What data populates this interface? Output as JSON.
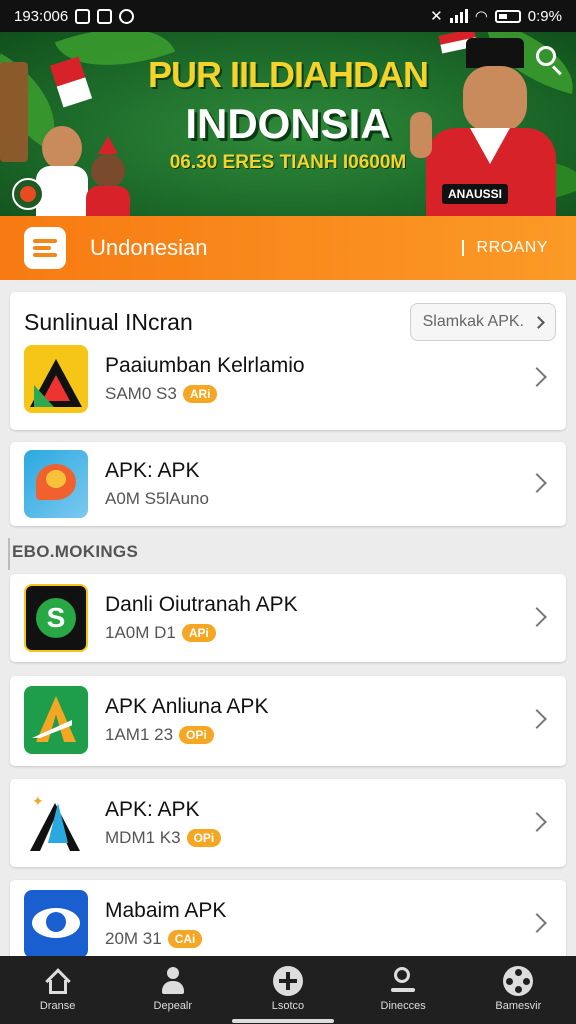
{
  "status_bar": {
    "time": "193:006",
    "battery": "0:9%"
  },
  "banner": {
    "title_line1": "PUR IILDIAHDAN",
    "title_line2": "INDONSIA",
    "subtitle": "06.30 ERES TIANH I0600M",
    "shirt_text": "ANAUSSI"
  },
  "header": {
    "title": "Undonesian",
    "right_label": "RROANY"
  },
  "featured": {
    "title": "Sunlinual INcran",
    "button_label": "Slamkak APK.",
    "items": [
      {
        "name": "Paaiumban Kelrlamio",
        "meta": "SAM0 S3",
        "tag": "ARi",
        "icon": "cube-a-icon"
      },
      {
        "name": "APK: APK",
        "meta": "A0M S5lAuno",
        "icon": "chat-bubble-icon"
      }
    ]
  },
  "rankings": {
    "title": "EBO.MOKINGS",
    "items": [
      {
        "name": "Danli Oiutranah APK",
        "meta": "1A0M D1",
        "tag": "APi",
        "icon": "dollar-s-icon"
      },
      {
        "name": "APK Anliuna APK",
        "meta": "1AM1 23",
        "tag": "OPi",
        "icon": "a-letter-icon"
      },
      {
        "name": "APK: APK",
        "meta": "MDM1 K3",
        "tag": "OPi",
        "icon": "sparkle-a-icon"
      },
      {
        "name": "Mabaim APK",
        "meta": "20M 31",
        "tag": "CAi",
        "icon": "eye-icon"
      }
    ]
  },
  "bottom_nav": [
    {
      "label": "Dranse",
      "icon": "home-icon"
    },
    {
      "label": "Depealr",
      "icon": "user-icon"
    },
    {
      "label": "Lsotco",
      "icon": "plus-circle-icon"
    },
    {
      "label": "Dinecces",
      "icon": "search-person-icon"
    },
    {
      "label": "Bamesvir",
      "icon": "film-reel-icon"
    }
  ]
}
